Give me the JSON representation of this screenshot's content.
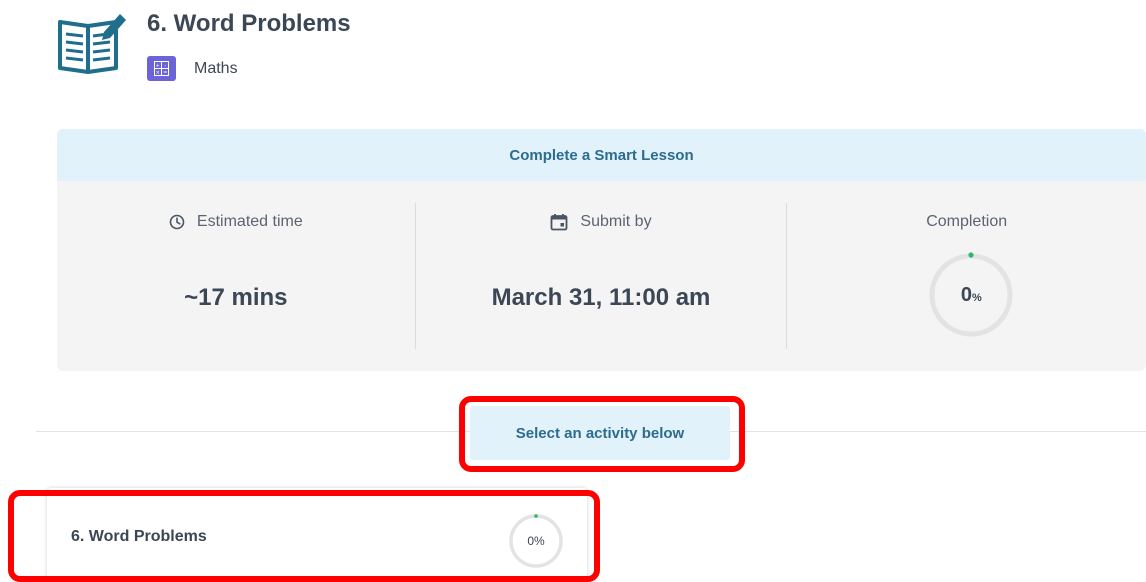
{
  "header": {
    "title": "6. Word Problems",
    "subject": "Maths",
    "icon": "book-pencil-icon",
    "subject_icon": "calculator-icon",
    "subject_color": "#6c63d8"
  },
  "summary": {
    "heading": "Complete a Smart Lesson",
    "estimated_time": {
      "label": "Estimated time",
      "value": "~17 mins",
      "icon": "clock-icon"
    },
    "submit_by": {
      "label": "Submit by",
      "value": "March 31, 11:00 am",
      "icon": "calendar-icon"
    },
    "completion": {
      "label": "Completion",
      "value": "0",
      "unit": "%",
      "percent": 0
    }
  },
  "activity_prompt": "Select an activity below",
  "activities": [
    {
      "title": "6. Word Problems",
      "progress_label": "0%",
      "percent": 0
    }
  ],
  "colors": {
    "accent_text": "#2d6c8e",
    "accent_bg": "#e1f2fa",
    "progress_dot": "#2ab96a",
    "highlight": "#ff0000"
  }
}
